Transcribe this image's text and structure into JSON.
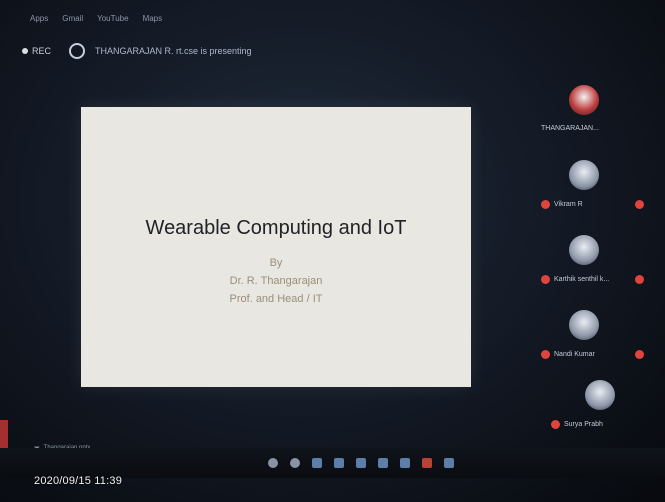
{
  "bookmarks": [
    "Apps",
    "Gmail",
    "YouTube",
    "Maps"
  ],
  "meeting": {
    "record_label": "REC",
    "presenter_status": "THANGARAJAN R. rt.cse is presenting"
  },
  "slide": {
    "title": "Wearable Computing and IoT",
    "by": "By",
    "author": "Dr. R. Thangarajan",
    "role": "Prof. and Head / IT"
  },
  "participants": [
    {
      "name": "THANGARAJAN..."
    },
    {
      "name": "Vikram R"
    },
    {
      "name": "Karthik senthil k..."
    },
    {
      "name": "Nandi Kumar"
    },
    {
      "name": "Surya Prabh"
    }
  ],
  "download": {
    "label": "Thangarajan.pptx"
  },
  "timestamp": "2020/09/15 11:39",
  "colors": {
    "mic_muted": "#e0453d",
    "slide_bg": "#e9e7e2"
  }
}
